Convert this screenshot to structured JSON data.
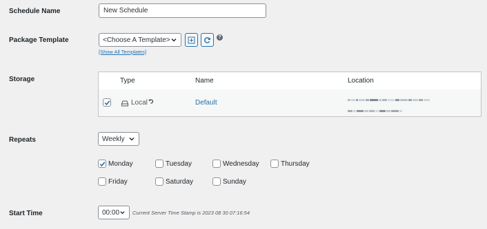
{
  "labels": {
    "schedule_name": "Schedule Name",
    "package_template": "Package Template",
    "storage": "Storage",
    "repeats": "Repeats",
    "start_time": "Start Time"
  },
  "schedule_name_value": "New Schedule",
  "template_select": "<Choose A Template>",
  "show_all_templates": "[Show All Templates]",
  "storage_table": {
    "headers": {
      "type": "Type",
      "name": "Name",
      "location": "Location"
    },
    "row": {
      "checked": true,
      "type": "Local",
      "name": "Default"
    }
  },
  "repeats_value": "Weekly",
  "days": [
    {
      "label": "Monday",
      "checked": true
    },
    {
      "label": "Tuesday",
      "checked": false
    },
    {
      "label": "Wednesday",
      "checked": false
    },
    {
      "label": "Thursday",
      "checked": false
    },
    {
      "label": "Friday",
      "checked": false
    },
    {
      "label": "Saturday",
      "checked": false
    },
    {
      "label": "Sunday",
      "checked": false
    }
  ],
  "start_time_value": "00:00",
  "server_time_note": "Current Server Time Stamp is  2023 08 30 07:16:54",
  "colors": {
    "accent": "#2271b1",
    "text": "#1d2327",
    "background": "#f0f0f1"
  }
}
